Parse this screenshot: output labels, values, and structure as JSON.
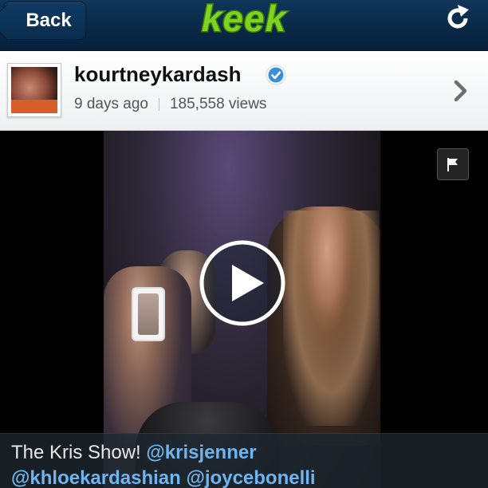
{
  "navbar": {
    "back_label": "Back",
    "logo_text": "keek",
    "refresh_icon": "refresh-icon"
  },
  "profile": {
    "username": "kourtneykardash",
    "verified_icon": "verified-badge-icon",
    "posted": "9 days ago",
    "views": "185,558 views",
    "chevron_icon": "chevron-right-icon"
  },
  "video": {
    "play_icon": "play-icon",
    "flag_icon": "flag-icon"
  },
  "caption": {
    "text": "The Kris Show!",
    "mentions": [
      "@krisjenner",
      "@khloekardashian",
      "@joycebonelli"
    ]
  },
  "colors": {
    "navbar": "#0b2a49",
    "logo_green": "#7ed321",
    "verified_blue": "#3b8fd9",
    "mention_blue": "#6fb4ef"
  }
}
